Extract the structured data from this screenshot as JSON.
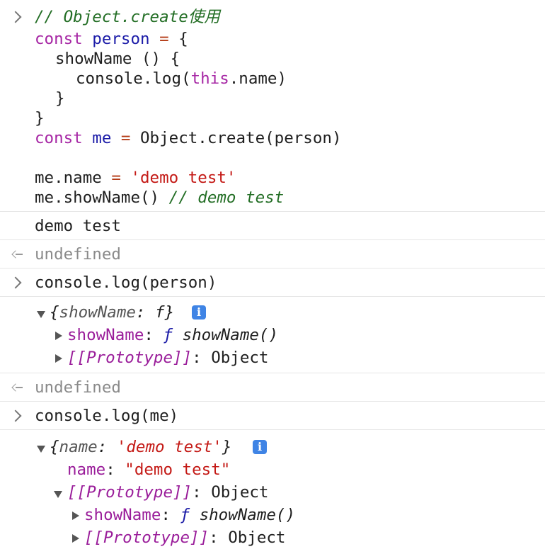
{
  "console": {
    "entry1": {
      "lines": [
        "// Object.create使用",
        "const",
        "person",
        "=",
        "{",
        "showName () {",
        "console.log(",
        "this",
        ".name)",
        "}",
        "}",
        "const",
        "me",
        "=",
        "Object.create(person)",
        "me.name",
        "=",
        "'demo test'",
        "me.showName()",
        "// demo test"
      ]
    },
    "output1": "demo test",
    "return1": "undefined",
    "input2": "console.log(person)",
    "obj1": {
      "summary_open": "{",
      "summary_key": "showName",
      "summary_sep": ": ",
      "summary_val": "f",
      "summary_close": "}",
      "info": "i",
      "prop1_key": "showName",
      "prop1_sep": ": ",
      "prop1_f": "ƒ",
      "prop1_val": "showName()",
      "prop2_key": "[[Prototype]]",
      "prop2_sep": ": ",
      "prop2_val": "Object"
    },
    "return2": "undefined",
    "input3": "console.log(me)",
    "obj2": {
      "summary_open": "{",
      "summary_key": "name",
      "summary_sep": ": ",
      "summary_val": "'demo test'",
      "summary_close": "}",
      "info": "i",
      "name_key": "name",
      "name_sep": ": ",
      "name_val": "\"demo test\"",
      "proto_key": "[[Prototype]]",
      "proto_sep": ": ",
      "proto_val": "Object",
      "inner_prop1_key": "showName",
      "inner_prop1_sep": ": ",
      "inner_prop1_f": "ƒ",
      "inner_prop1_val": "showName()",
      "inner_prop2_key": "[[Prototype]]",
      "inner_prop2_sep": ": ",
      "inner_prop2_val": "Object"
    }
  }
}
